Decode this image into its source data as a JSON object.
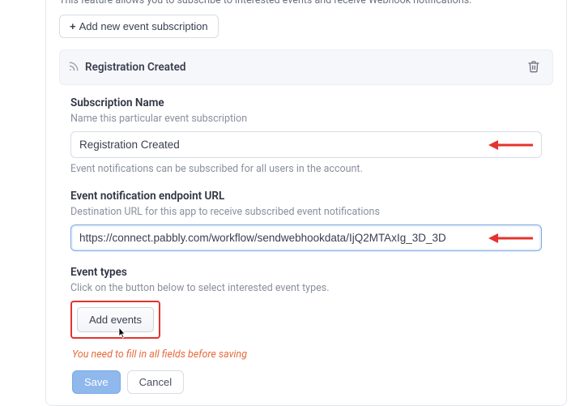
{
  "feature_desc": "This feature allows you to subscribe to interested events and receive Webhook notifications.",
  "add_subscription_label": "Add new event subscription",
  "subscription": {
    "header_title": "Registration Created"
  },
  "fields": {
    "name": {
      "label": "Subscription Name",
      "help": "Name this particular event subscription",
      "value": "Registration Created",
      "note": "Event notifications can be subscribed for all users in the account."
    },
    "endpoint": {
      "label": "Event notification endpoint URL",
      "help": "Destination URL for this app to receive subscribed event notifications",
      "value": "https://connect.pabbly.com/workflow/sendwebhookdata/IjQ2MTAxIg_3D_3D"
    },
    "events": {
      "label": "Event types",
      "help": "Click on the button below to select interested event types.",
      "add_button": "Add events"
    }
  },
  "warning": "You need to fill in all fields before saving",
  "actions": {
    "save": "Save",
    "cancel": "Cancel"
  },
  "annotation_color": "#e5322d"
}
